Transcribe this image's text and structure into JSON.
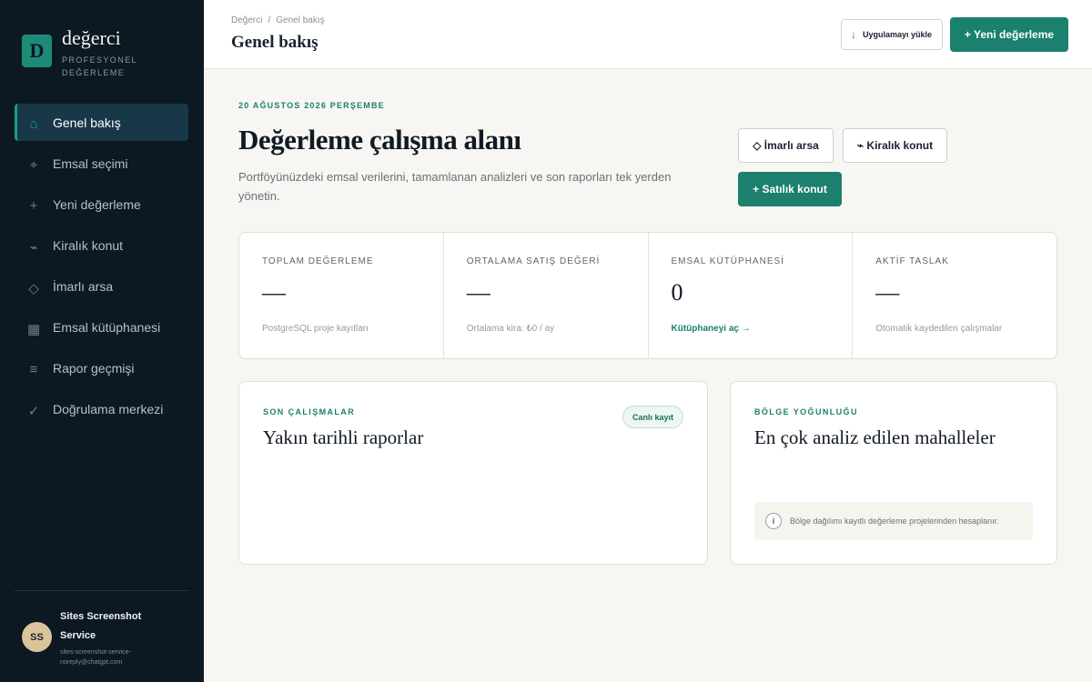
{
  "brand": {
    "logo_letter": "D",
    "name": "değerci",
    "subtitle": "PROFESYONEL DEĞERLEME"
  },
  "sidebar": {
    "items": [
      {
        "label": "Genel bakış",
        "icon": "home-icon",
        "glyph": "⌂",
        "active": true
      },
      {
        "label": "Emsal seçimi",
        "icon": "target-icon",
        "glyph": "⌖",
        "active": false
      },
      {
        "label": "Yeni değerleme",
        "icon": "plus-icon",
        "glyph": "+",
        "active": false
      },
      {
        "label": "Kiralık konut",
        "icon": "key-icon",
        "glyph": "⌁",
        "active": false
      },
      {
        "label": "İmarlı arsa",
        "icon": "diamond-icon",
        "glyph": "◇",
        "active": false
      },
      {
        "label": "Emsal kütüphanesi",
        "icon": "grid-icon",
        "glyph": "▦",
        "active": false
      },
      {
        "label": "Rapor geçmişi",
        "icon": "list-icon",
        "glyph": "≡",
        "active": false
      },
      {
        "label": "Doğrulama merkezi",
        "icon": "check-icon",
        "glyph": "✓",
        "active": false
      }
    ]
  },
  "user": {
    "initials": "SS",
    "name": "Sites Screenshot Service",
    "email": "sites-screenshot-service-noreply@chatgpt.com"
  },
  "topbar": {
    "breadcrumb": [
      "Değerci",
      "Genel bakış"
    ],
    "breadcrumb_sep": "/",
    "title": "Genel bakış",
    "install_label": "Uygulamayı yükle",
    "new_label": "+ Yeni değerleme"
  },
  "hero": {
    "date": "20 AĞUSTOS 2026 PERŞEMBE",
    "title": "Değerleme çalışma alanı",
    "description": "Portföyünüzdeki emsal verilerini, tamamlanan analizleri ve son raporları tek yerden yönetin.",
    "buttons": {
      "imarli": "◇ İmarlı arsa",
      "kiralik": "⌁ Kiralık konut",
      "satilik": "+ Satılık konut"
    }
  },
  "stats": [
    {
      "label": "TOPLAM DEĞERLEME",
      "value": "—",
      "note": "PostgreSQL proje kayıtları"
    },
    {
      "label": "ORTALAMA SATIŞ DEĞERİ",
      "value": "—",
      "note": "Ortalama kira: ₺0 / ay"
    },
    {
      "label": "EMSAL KÜTÜPHANESİ",
      "value": "0",
      "note": "Kütüphaneyi aç →"
    },
    {
      "label": "AKTİF TASLAK",
      "value": "—",
      "note": "Otomatik kaydedilen çalışmalar"
    }
  ],
  "recent": {
    "kicker": "SON ÇALIŞMALAR",
    "title": "Yakın tarihli raporlar",
    "badge": "Canlı kayıt"
  },
  "region": {
    "kicker": "BÖLGE YOĞUNLUĞU",
    "title": "En çok analiz edilen mahalleler",
    "info_icon": "i",
    "info": "Bölge dağılımı kayıtlı değerleme projelerinden hesaplanır."
  }
}
